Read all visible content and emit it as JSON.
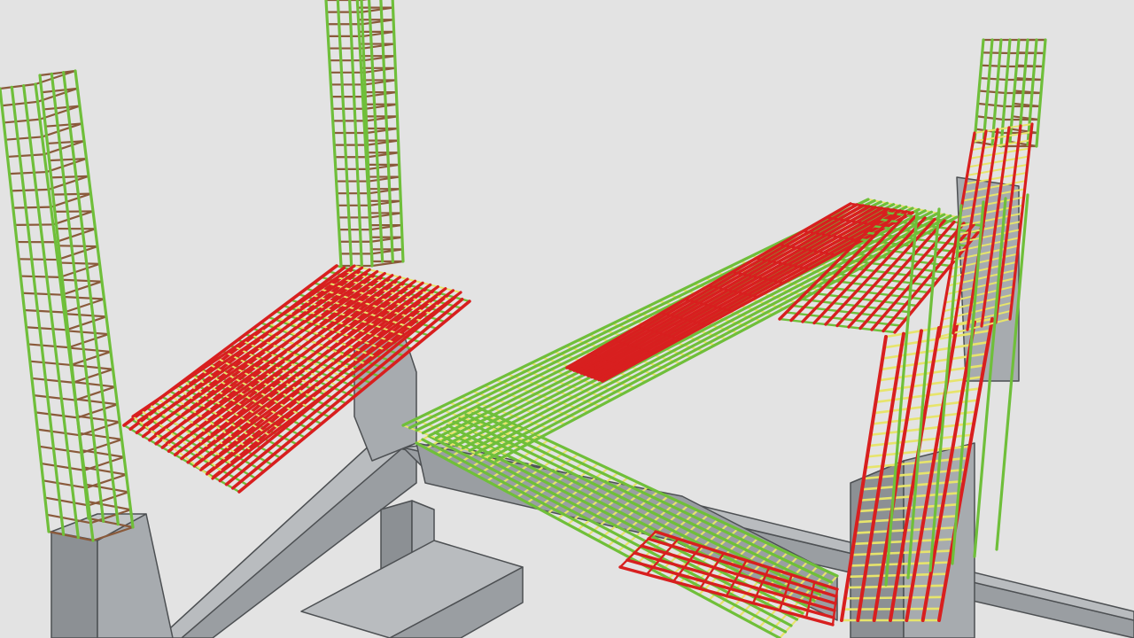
{
  "scene": {
    "description_label": "",
    "colors": {
      "background": "#e3e3e3",
      "concrete_light": "#b9bcbf",
      "concrete_mid": "#9a9ea2",
      "concrete_dark": "#7c8084",
      "concrete_edge": "#4d5053",
      "rebar_red": "#d81f1f",
      "rebar_red_dark": "#8e1010",
      "rebar_green": "#6fbf3a",
      "rebar_green_dark": "#3f7d1f",
      "rebar_yellow": "#e7e46b",
      "rebar_brown": "#8a5a3b"
    }
  }
}
